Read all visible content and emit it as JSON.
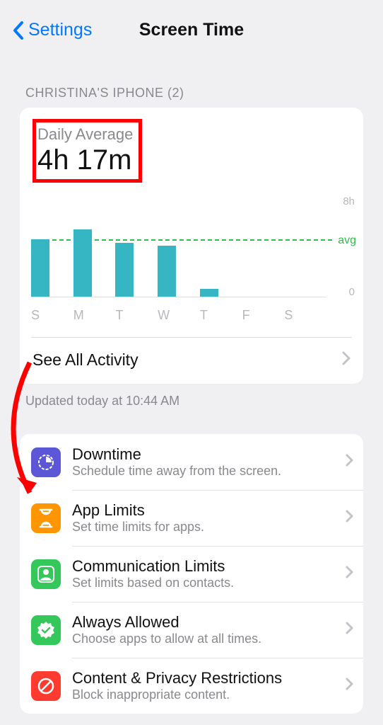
{
  "nav": {
    "back_label": "Settings",
    "title": "Screen Time"
  },
  "section_label": "CHRISTINA'S IPHONE (2)",
  "summary": {
    "avg_label": "Daily Average",
    "avg_value": "4h 17m",
    "see_all": "See All Activity",
    "updated": "Updated today at 10:44 AM"
  },
  "chart_data": {
    "type": "bar",
    "categories": [
      "S",
      "M",
      "T",
      "W",
      "T",
      "F",
      "S"
    ],
    "values": [
      4.5,
      5.3,
      4.2,
      4.0,
      0.6,
      0,
      0
    ],
    "avg_line_value": 4.28,
    "ylim": [
      0,
      8
    ],
    "ymax_label": "8h",
    "ymin_label": "0",
    "avg_label": "avg"
  },
  "options": [
    {
      "title": "Downtime",
      "sub": "Schedule time away from the screen.",
      "icon": "clock-half-icon",
      "color": "#5b57d6"
    },
    {
      "title": "App Limits",
      "sub": "Set time limits for apps.",
      "icon": "hourglass-icon",
      "color": "#ff9500"
    },
    {
      "title": "Communication Limits",
      "sub": "Set limits based on contacts.",
      "icon": "contact-icon",
      "color": "#34c759"
    },
    {
      "title": "Always Allowed",
      "sub": "Choose apps to allow at all times.",
      "icon": "check-badge-icon",
      "color": "#34c759"
    },
    {
      "title": "Content & Privacy Restrictions",
      "sub": "Block inappropriate content.",
      "icon": "no-entry-icon",
      "color": "#ff3b30"
    }
  ],
  "annotations": {
    "avg_highlight": true,
    "arrow_to": "App Limits"
  }
}
